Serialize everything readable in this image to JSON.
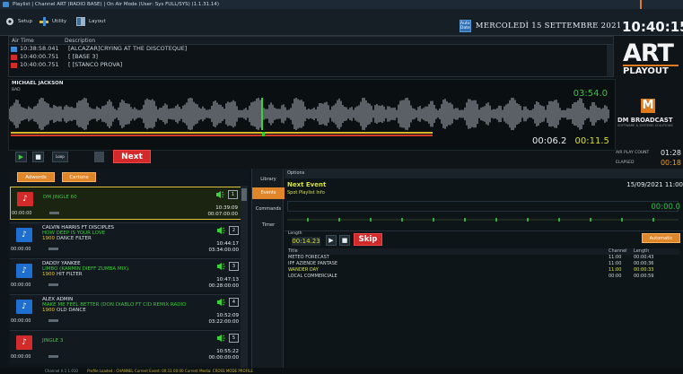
{
  "titlebar": {
    "text": "Playlist | Channel ART (RADIO BASE) | On Air Mode (User: Sys FULL/SYS) (1.1.31.14)"
  },
  "toolbar": {
    "buttons": [
      {
        "label": "Setup",
        "icon": "gear-icon"
      },
      {
        "label": "Utility",
        "icon": "tools-icon"
      },
      {
        "label": "Layout",
        "icon": "layout-icon"
      }
    ],
    "date_icon_label": "Auto Date",
    "date": "MERCOLEDÌ 15 SETTEMBRE 2021",
    "clock": "10:40:15"
  },
  "playlist": {
    "headers": [
      "Air Time",
      "Description"
    ],
    "rows": [
      {
        "time": "10:38:58.041",
        "desc": "[ALCAZAR]CRYING AT THE DISCOTEQUE]",
        "icon": "music-note-icon",
        "color": "#3d8bd6"
      },
      {
        "time": "10:40:00.751",
        "desc": "[ [BASE 3]",
        "icon": "jingle-icon",
        "color": "#d32b2b"
      },
      {
        "time": "10:40:00.751",
        "desc": "[ [STANCO PROVA]",
        "icon": "jingle-icon",
        "color": "#d32b2b"
      }
    ]
  },
  "logo": {
    "art": "ART",
    "playout": "PLAYOUT",
    "dm_mark": "M",
    "dm_name": "DM BROADCAST",
    "dm_sub": "SOFTWARE & SYSTEMS SOLUTIONS"
  },
  "wave": {
    "artist": "MICHAEL JACKSON",
    "subtitle": "BAD",
    "remaining": "03:54.0",
    "elapsed": "00:06.2",
    "total": "00:11.5"
  },
  "onair_info": [
    {
      "label": "AIR PLAY COUNT",
      "value": "01:28",
      "orange": false
    },
    {
      "label": "ELAPSED",
      "value": "00:18",
      "orange": true
    }
  ],
  "transport": {
    "play": "▶",
    "stop": "■",
    "loop_label": "Loop",
    "next": "Next"
  },
  "left_tabs": [
    "Adwords",
    "Cartons"
  ],
  "carts": [
    {
      "artist": "",
      "title": "DM JINGLE 60",
      "year": "",
      "genre": "",
      "left_time": "00:00:00",
      "badge": "Online",
      "t1": "10:39:09",
      "t2": "00:07:00:00",
      "num": "1",
      "thumb": "red",
      "icon": "music-file-icon",
      "selected": true
    },
    {
      "artist": "CALVIN HARRIS FT DISCIPLES",
      "title": "HOW DEEP IS YOUR LOVE",
      "year": "1900",
      "genre": "DANCE FILTER",
      "left_time": "00:00:00",
      "badge": "Online",
      "t1": "10:44:17",
      "t2": "03:34:00:00",
      "num": "2",
      "thumb": "blue",
      "icon": "music-note-icon",
      "selected": false
    },
    {
      "artist": "DADDY YANKEE",
      "title": "LIMBO (KARMIN DIEFF ZUMBA MIX)",
      "year": "1900",
      "genre": "HIT FILTER",
      "left_time": "00:00:00",
      "badge": "Online",
      "t1": "10:47:13",
      "t2": "00:28:00:00",
      "num": "3",
      "thumb": "blue",
      "icon": "music-note-icon",
      "selected": false
    },
    {
      "artist": "ALEX ADMIN",
      "title": "MAKE ME FEEL BETTER (DON DIABLO FT CID REMIX RADIO",
      "year": "1900",
      "genre": "OLD DANCE",
      "left_time": "00:00:00",
      "badge": "Online",
      "t1": "10:52:09",
      "t2": "03:22:00:00",
      "num": "4",
      "thumb": "blue",
      "icon": "music-note-icon",
      "selected": false
    },
    {
      "artist": "",
      "title": "JINGLE 3",
      "year": "",
      "genre": "",
      "left_time": "00:00:00",
      "badge": "Online",
      "t1": "10:55:22",
      "t2": "00:00:00:00",
      "num": "5",
      "thumb": "red",
      "icon": "music-file-icon",
      "selected": false
    }
  ],
  "mid_nav": [
    "Library",
    "Events",
    "Commands",
    "Timer"
  ],
  "event": {
    "tab_label": "Options",
    "title": "Next Event",
    "subtitle": "Spot Playlist Info",
    "date": "15/09/2021 11:00",
    "countdown": "00:00.0"
  },
  "skip_panel": {
    "length_label": "Length",
    "length": "00:14.23",
    "play": "▶",
    "stop": "■",
    "skip": "Skip",
    "automatic": "Automatic",
    "headers": [
      "Title",
      "Channel",
      "Length"
    ],
    "rows": [
      {
        "title": "METEO FORECAST",
        "ch": "11:00",
        "len": "00:00:43"
      },
      {
        "title": "IPF AZIENDE PANTASE",
        "ch": "11:00",
        "len": "00:00:36"
      },
      {
        "title": "WANDER DAY",
        "ch": "11:00",
        "len": "00:00:33",
        "hl": true
      },
      {
        "title": "LOCAL COMMERCIALE",
        "ch": "00:00",
        "len": "00:00:59"
      }
    ]
  },
  "statusbar": {
    "left": "Channel A 1 1.010",
    "mid": "Profile Loaded : CHANNEL  Current Event: 00:11 00:00  Current Media: CROSS MODE PROFILE"
  }
}
